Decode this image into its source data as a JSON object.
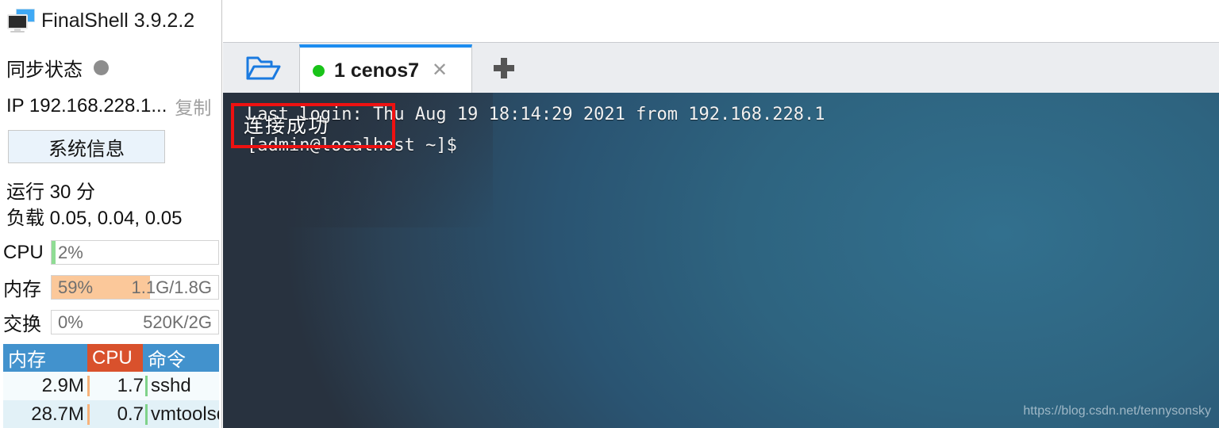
{
  "app": {
    "title": "FinalShell 3.9.2.2",
    "icon": "monitors-icon"
  },
  "sidebar": {
    "sync": {
      "label": "同步状态",
      "status_icon": "status-dot-idle",
      "color": "#8d8d8d"
    },
    "ip": {
      "label": "IP 192.168.228.1...",
      "copy_label": "复制"
    },
    "sysinfo_button": "系统信息",
    "uptime": "运行 30 分",
    "load": "负载 0.05, 0.04, 0.05",
    "metrics": [
      {
        "name": "cpu",
        "label": "CPU",
        "percent": "2%",
        "percent_value": 2,
        "detail": "",
        "fill_color": "#8fdc94"
      },
      {
        "name": "mem",
        "label": "内存",
        "percent": "59%",
        "percent_value": 59,
        "detail": "1.1G/1.8G",
        "fill_color": "#fbc89a"
      },
      {
        "name": "swap",
        "label": "交换",
        "percent": "0%",
        "percent_value": 0,
        "detail": "520K/2G",
        "fill_color": "#fbc89a"
      }
    ],
    "process_table": {
      "headers": [
        "内存",
        "CPU",
        "命令"
      ],
      "rows": [
        {
          "mem": "2.9M",
          "cpu": "1.7",
          "cmd": "sshd"
        },
        {
          "mem": "28.7M",
          "cpu": "0.7",
          "cmd": "vmtoolsd"
        }
      ]
    }
  },
  "tabbar": {
    "folder_button_icon": "open-folder-icon",
    "tabs": [
      {
        "label": "1 cenos7",
        "status_icon": "connected-dot",
        "status_color": "#19c319",
        "close_icon": "close-icon"
      }
    ],
    "new_tab_icon": "plus-icon"
  },
  "terminal": {
    "annotation": "连接成功",
    "annotation_color": "#ee1111",
    "lines": [
      "Last login: Thu Aug 19 18:14:29 2021 from 192.168.228.1",
      "[admin@localhost ~]$"
    ],
    "watermark": "https://blog.csdn.net/tennysonsky"
  }
}
